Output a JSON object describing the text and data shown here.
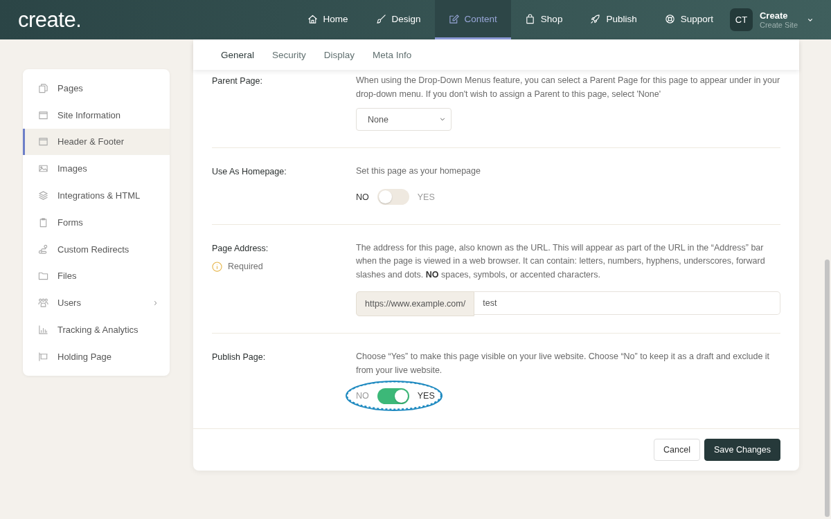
{
  "header": {
    "logo": "create.",
    "nav": [
      {
        "label": "Home",
        "selected": false
      },
      {
        "label": "Design",
        "selected": false
      },
      {
        "label": "Content",
        "selected": true
      },
      {
        "label": "Shop",
        "selected": false
      },
      {
        "label": "Publish",
        "selected": false
      },
      {
        "label": "Support",
        "selected": false
      }
    ],
    "account": {
      "initials": "CT",
      "name": "Create",
      "subtitle": "Create Site"
    }
  },
  "sidebar": {
    "items": [
      {
        "label": "Pages",
        "selected": false,
        "has_submenu": false
      },
      {
        "label": "Site Information",
        "selected": false,
        "has_submenu": false
      },
      {
        "label": "Header & Footer",
        "selected": true,
        "has_submenu": false
      },
      {
        "label": "Images",
        "selected": false,
        "has_submenu": false
      },
      {
        "label": "Integrations & HTML",
        "selected": false,
        "has_submenu": false
      },
      {
        "label": "Forms",
        "selected": false,
        "has_submenu": false
      },
      {
        "label": "Custom Redirects",
        "selected": false,
        "has_submenu": false
      },
      {
        "label": "Files",
        "selected": false,
        "has_submenu": false
      },
      {
        "label": "Users",
        "selected": false,
        "has_submenu": true
      },
      {
        "label": "Tracking & Analytics",
        "selected": false,
        "has_submenu": false
      },
      {
        "label": "Holding Page",
        "selected": false,
        "has_submenu": false
      }
    ]
  },
  "tabs": [
    {
      "label": "General",
      "selected": true
    },
    {
      "label": "Security",
      "selected": false
    },
    {
      "label": "Display",
      "selected": false
    },
    {
      "label": "Meta Info",
      "selected": false
    }
  ],
  "fields": [
    {
      "kind": "select",
      "label": "Parent Page:",
      "description": "When using the Drop-Down Menus feature, you can select a Parent Page for this page to appear under in your drop-down menu. If you don't wish to assign a Parent to this page, select 'None'",
      "value": "None"
    },
    {
      "kind": "toggle",
      "label": "Use As Homepage:",
      "description": "Set this page as your homepage",
      "off_label": "NO",
      "on_label": "YES",
      "on": false,
      "highlighted": false
    },
    {
      "kind": "address",
      "label": "Page Address:",
      "note": "Required",
      "description": "The address for this page, also known as the URL. This will appear as part of the URL in the “Address” bar when the page is viewed in a web browser. It can contain: letters, numbers, hyphens, underscores, forward slashes and dots. **NO** spaces, symbols, or accented characters.",
      "prefix": "https://www.example.com/",
      "value": "test"
    },
    {
      "kind": "toggle",
      "label": "Publish Page:",
      "description": "Choose “Yes” to make this page visible on your live website. Choose “No” to keep it as a draft and exclude it from your live website.",
      "off_label": "NO",
      "on_label": "YES",
      "on": true,
      "highlighted": true
    }
  ],
  "buttons": [
    {
      "label": "Cancel",
      "kind": "secondary"
    },
    {
      "label": "Save Changes",
      "kind": "primary"
    }
  ]
}
